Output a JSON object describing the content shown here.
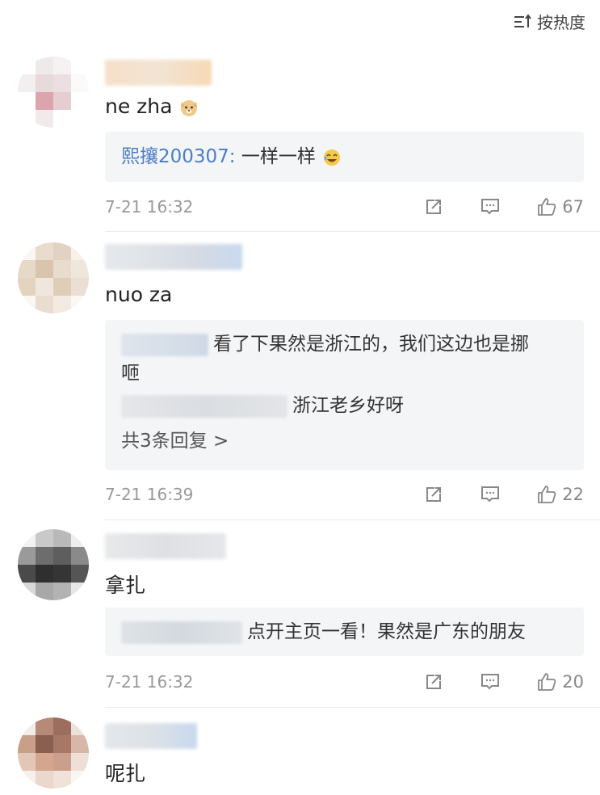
{
  "sort": {
    "label": "按热度"
  },
  "comments": [
    {
      "body": "ne zha",
      "replies": [
        {
          "author": "熙攘200307:",
          "text": " 一样一样"
        }
      ],
      "timestamp": "7-21 16:32",
      "likes": "67"
    },
    {
      "body": "nuo za",
      "replies": [
        {
          "text": "看了下果然是浙江的，我们这边也是挪",
          "text2": "咂"
        },
        {
          "text": "浙江老乡好呀"
        }
      ],
      "more": "共3条回复 >",
      "timestamp": "7-21 16:39",
      "likes": "22"
    },
    {
      "body": "拿扎",
      "replies": [
        {
          "text": "点开主页一看！果然是广东的朋友"
        }
      ],
      "timestamp": "7-21 16:32",
      "likes": "20"
    },
    {
      "body": "呢扎"
    }
  ],
  "colors": {
    "accent_link": "#4a7ec8",
    "muted": "#999999",
    "reply_bg": "#f4f5f7"
  },
  "icons": [
    "sort-icon",
    "share-icon",
    "comment-icon",
    "like-icon",
    "dog-emoji-icon",
    "laugh-emoji-icon"
  ]
}
